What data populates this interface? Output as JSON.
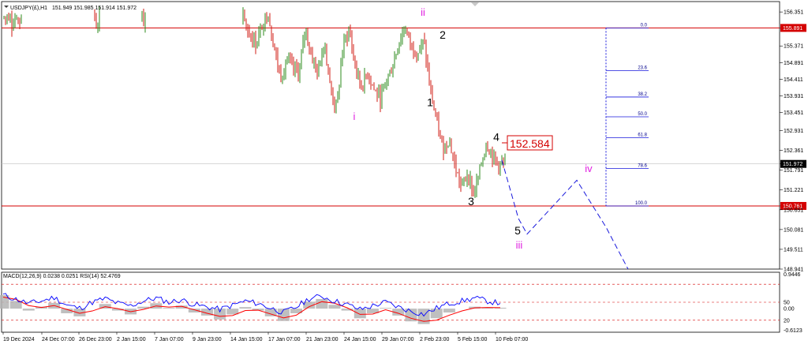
{
  "header": {
    "symbol": "USDJPY(£),H1",
    "ohlc": "151.949 151.985 151.914 151.972"
  },
  "indicator_header": "MACD(12,26,9) 0.0238 0.0251 RSI(14) 52.4769",
  "colors": {
    "bull": "#2e8b1e",
    "bear": "#d21e14",
    "level_line": "#d40000",
    "projection": "#1a1adc",
    "wave_minor": "#e020e0",
    "rsi": "#0000ff",
    "macd_signal": "#ff0000",
    "histogram": "#b4b4b4"
  },
  "chart_data": [
    {
      "type": "line",
      "title": "USDJPY(£),H1",
      "ylim": [
        148.941,
        156.65
      ],
      "y_ticks": [
        "156.351",
        "155.891",
        "155.371",
        "154.891",
        "154.411",
        "153.931",
        "153.451",
        "152.931",
        "152.361",
        "151.972",
        "151.791",
        "151.221",
        "150.761",
        "150.651",
        "150.081",
        "149.511",
        "148.941"
      ],
      "x_ticks": [
        "19 Dec 2024",
        "24 Dec 07:00",
        "26 Dec 23:00",
        "2 Jan 15:00",
        "7 Jan 07:00",
        "9 Jan 23:00",
        "14 Jan 15:00",
        "17 Jan 07:00",
        "21 Jan 23:00",
        "24 Jan 15:00",
        "29 Jan 07:00",
        "2 Feb 23:00",
        "5 Feb 15:00",
        "10 Feb 07:00"
      ],
      "horizontal_levels": [
        155.891,
        150.761
      ],
      "current_price": 151.972,
      "callout": "152.584",
      "wave_labels": [
        {
          "text": "ii",
          "style": "minor",
          "price": 156.35
        },
        {
          "text": "i",
          "style": "minor",
          "price": 153.35
        },
        {
          "text": "2",
          "style": "major",
          "price": 155.7
        },
        {
          "text": "1",
          "style": "major",
          "price": 153.75
        },
        {
          "text": "4",
          "style": "major",
          "price": 152.75
        },
        {
          "text": "3",
          "style": "major",
          "price": 150.9
        },
        {
          "text": "5",
          "style": "major",
          "price": 150.05
        },
        {
          "text": "iii",
          "style": "minor",
          "price": 149.65
        },
        {
          "text": "iv",
          "style": "minor",
          "price": 151.85
        }
      ],
      "projection_path": [
        152.08,
        150.4,
        149.95,
        151.5,
        150.15,
        148.94
      ],
      "fibonacci": {
        "levels": [
          "0.0",
          "23.6",
          "38.2",
          "50.0",
          "61.8",
          "78.6",
          "100.0"
        ],
        "prices": [
          155.891,
          154.66,
          153.9,
          153.33,
          152.73,
          151.84,
          150.761
        ]
      },
      "price_path": [
        156.15,
        155.7,
        155.45,
        155.95,
        156.35,
        155.3,
        154.45,
        155.0,
        154.7,
        154.6,
        155.9,
        155.1,
        154.55,
        155.6,
        154.1,
        153.55,
        155.35,
        155.85,
        154.75,
        154.2,
        154.6,
        154.1,
        153.85,
        154.4,
        154.8,
        155.5,
        155.9,
        155.35,
        155.2,
        155.5,
        154.1,
        153.2,
        152.4,
        152.7,
        151.9,
        151.3,
        151.7,
        151.1,
        151.8,
        152.584,
        152.2,
        151.95,
        151.972
      ]
    },
    {
      "type": "line",
      "title": "MACD(12,26,9) 0.0238 0.0251 RSI(14) 52.4769",
      "ylim": [
        -0.6123,
        0.9446
      ],
      "y_ticks": [
        "0.9446",
        "50",
        "0.00",
        "20",
        "-0.6123"
      ],
      "rsi_levels": [
        80,
        50,
        20
      ],
      "series": [
        {
          "name": "RSI(14)",
          "values": [
            62,
            55,
            48,
            52,
            58,
            45,
            40,
            50,
            56,
            48,
            44,
            52,
            57,
            50,
            54,
            46,
            42,
            38,
            45,
            52,
            48,
            40,
            33,
            42,
            56,
            60,
            52,
            46,
            38,
            44,
            50,
            42,
            35,
            30,
            40,
            48,
            52,
            57,
            52,
            48
          ]
        },
        {
          "name": "MACD",
          "values": [
            0.35,
            0.2,
            -0.05,
            0.05,
            0.15,
            -0.12,
            -0.2,
            0.0,
            0.12,
            -0.05,
            -0.15,
            0.05,
            0.14,
            0.02,
            0.08,
            -0.1,
            -0.18,
            -0.28,
            -0.15,
            0.04,
            -0.05,
            -0.2,
            -0.32,
            -0.12,
            0.18,
            0.25,
            0.1,
            -0.05,
            -0.25,
            -0.12,
            0.02,
            -0.18,
            -0.33,
            -0.4,
            -0.25,
            -0.1,
            0.0,
            0.05,
            0.03,
            0.0238
          ]
        },
        {
          "name": "Signal",
          "values": [
            0.3,
            0.24,
            0.08,
            0.03,
            0.08,
            -0.02,
            -0.12,
            -0.06,
            0.05,
            0.0,
            -0.08,
            -0.02,
            0.07,
            0.04,
            0.06,
            -0.03,
            -0.12,
            -0.2,
            -0.18,
            -0.05,
            -0.04,
            -0.14,
            -0.24,
            -0.17,
            0.05,
            0.18,
            0.14,
            0.02,
            -0.15,
            -0.14,
            -0.03,
            -0.12,
            -0.25,
            -0.33,
            -0.3,
            -0.17,
            -0.06,
            0.02,
            0.03,
            0.0251
          ]
        }
      ]
    }
  ]
}
